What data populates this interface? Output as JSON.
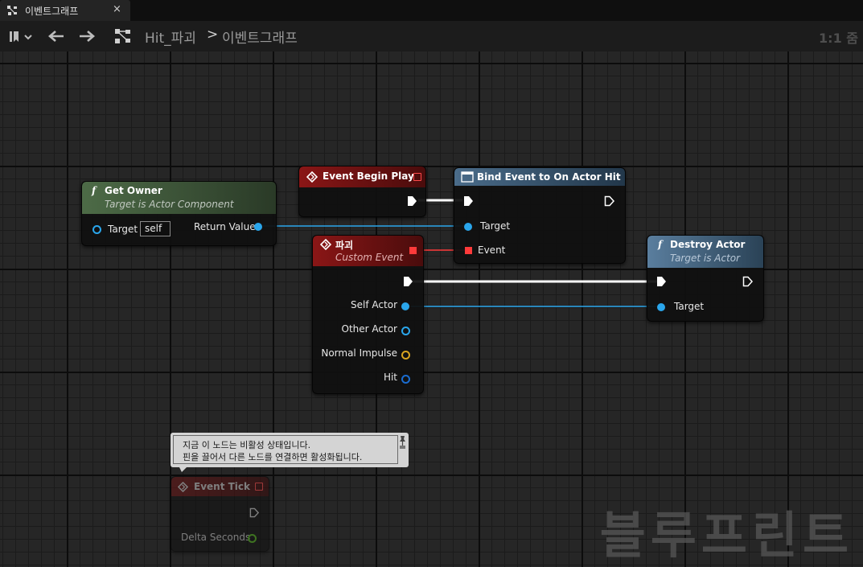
{
  "tab": {
    "title": "이벤트그래프",
    "close": "×",
    "icon": "graph-icon"
  },
  "toolbar": {
    "breadcrumb_parent": "Hit_파괴",
    "breadcrumb_sep": ">",
    "breadcrumb_current": "이벤트그래프",
    "zoom": "1:1 줌"
  },
  "watermark": "블루프린트",
  "colors": {
    "function_header_green": "#3f5a3a",
    "event_header_red": "#7a1717",
    "function_header_blue": "#3b5a78",
    "exec_wire": "#ffffff",
    "object_wire": "#2aa6ec",
    "delegate_wire": "#ff3a3a"
  },
  "nodes": {
    "get_owner": {
      "icon": "f",
      "title": "Get Owner",
      "subtitle": "Target is Actor Component",
      "in_target": "Target",
      "self_value": "self",
      "out_return": "Return Value"
    },
    "begin_play": {
      "title": "Event Begin Play"
    },
    "bind_event": {
      "title": "Bind Event to On Actor Hit",
      "in_target": "Target",
      "in_event": "Event"
    },
    "custom_event": {
      "title": "파괴",
      "subtitle": "Custom Event",
      "pins": [
        "Self Actor",
        "Other Actor",
        "Normal Impulse",
        "Hit"
      ]
    },
    "destroy_actor": {
      "icon": "f",
      "title": "Destroy Actor",
      "subtitle": "Target is Actor",
      "in_target": "Target"
    },
    "event_tick": {
      "title": "Event Tick",
      "out_delta": "Delta Seconds"
    }
  },
  "tooltip": {
    "line1": "지금 이 노드는 비활성 상태입니다.",
    "line2": "핀을 끌어서 다른 노드를 연결하면 활성화됩니다."
  }
}
